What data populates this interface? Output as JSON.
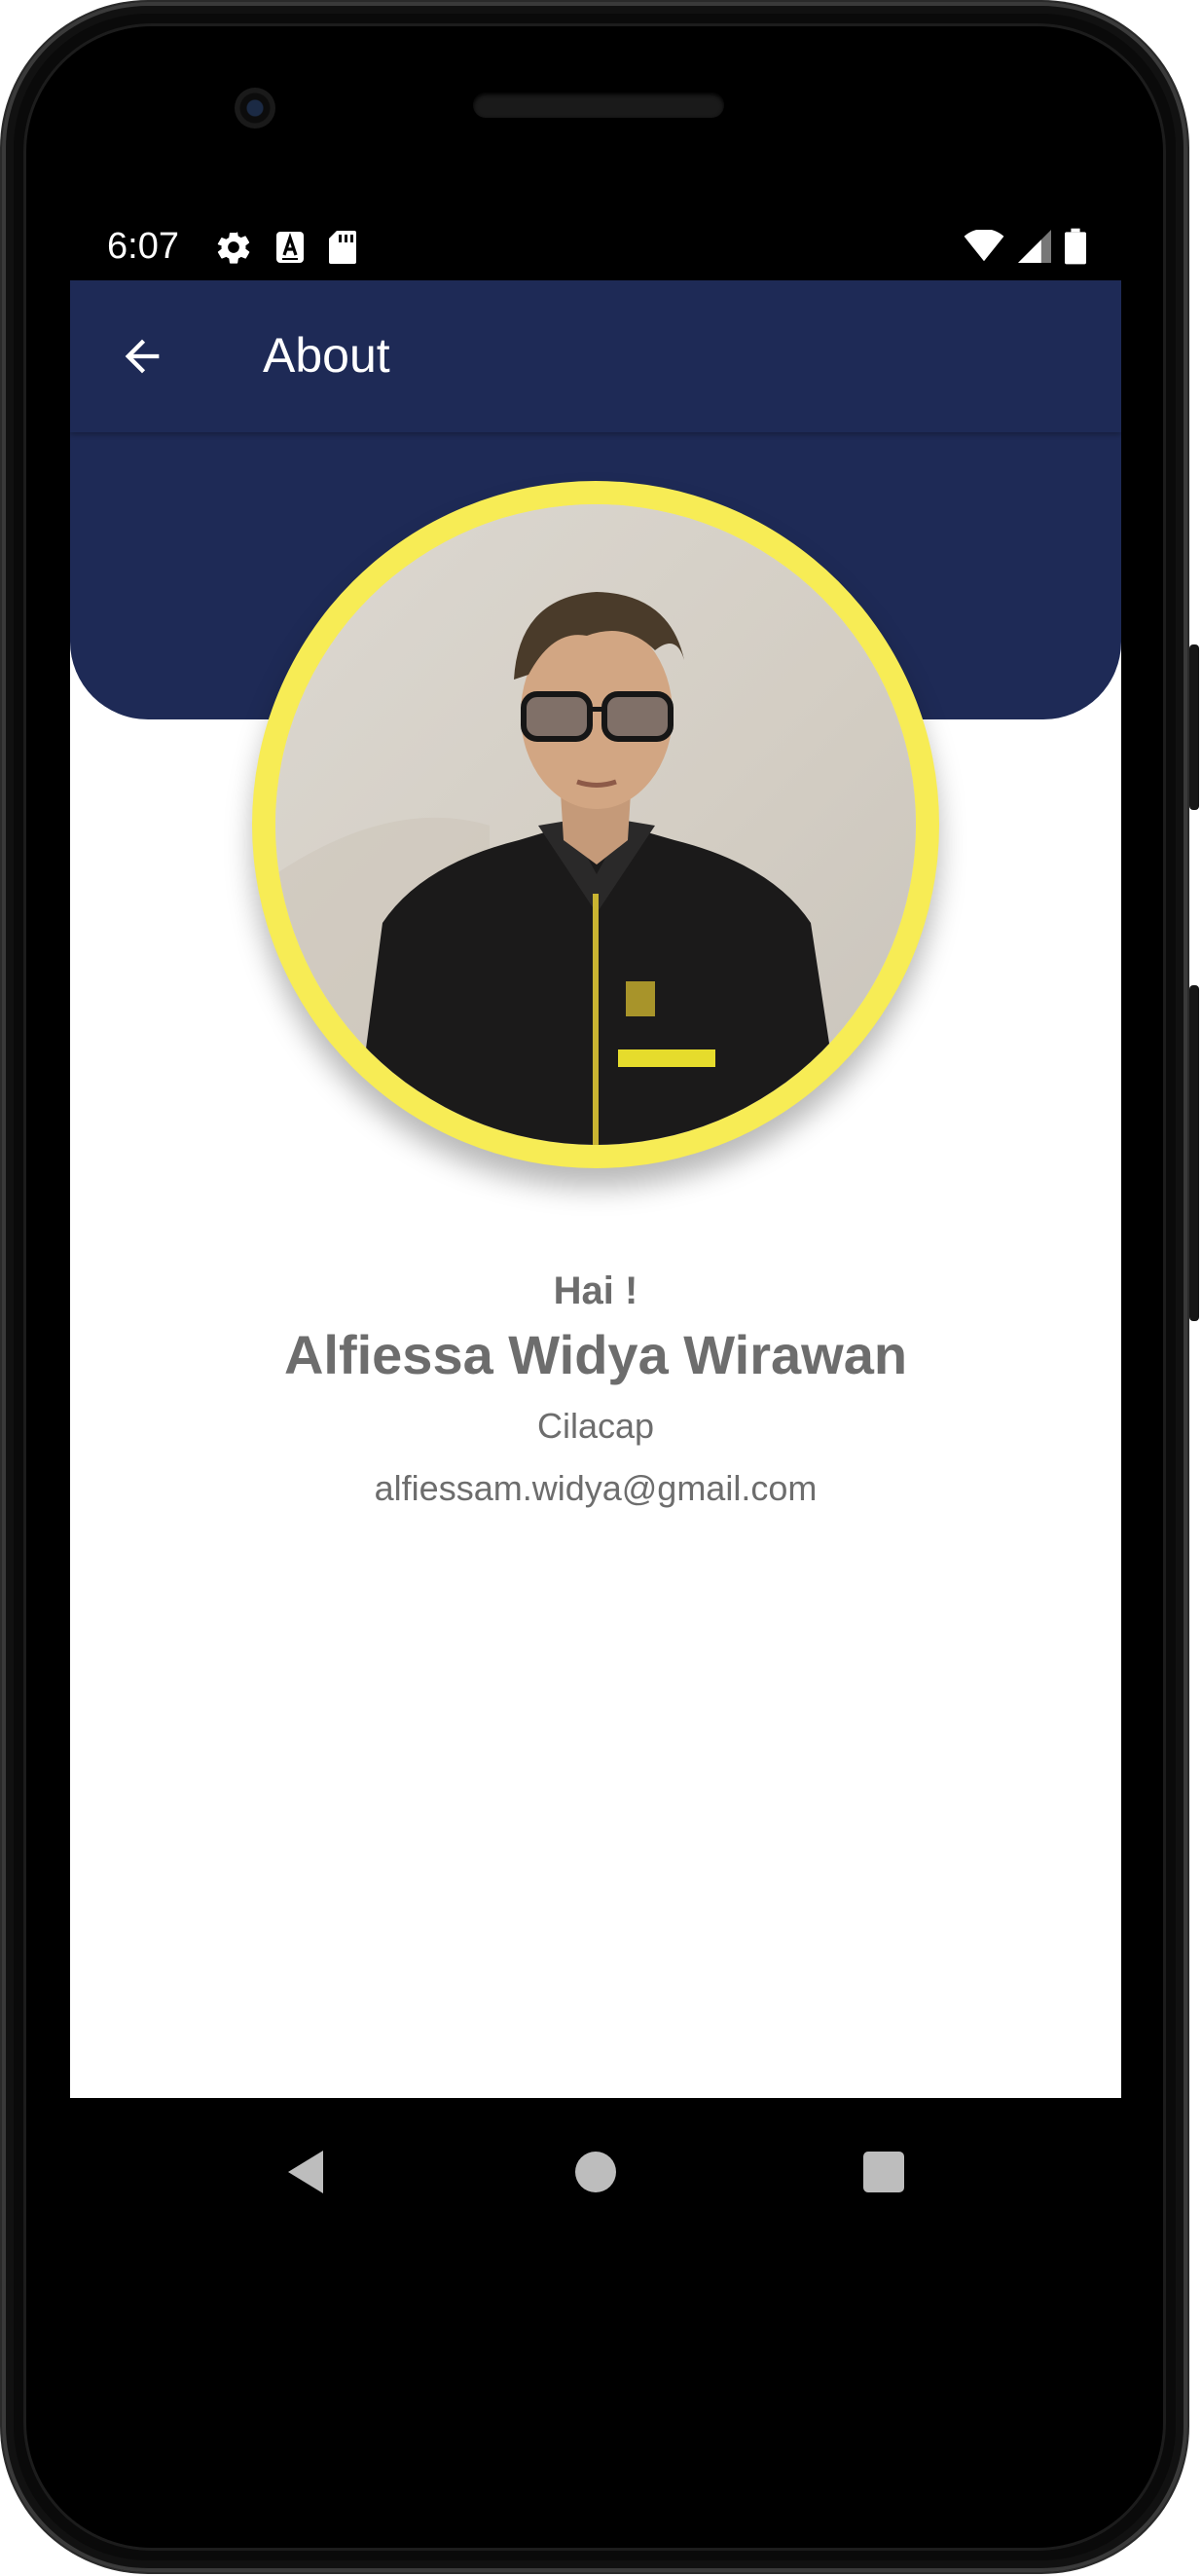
{
  "statusbar": {
    "time": "6:07",
    "left_icons": [
      "gear-icon",
      "a-badge-icon",
      "sd-card-icon"
    ],
    "right_icons": [
      "wifi-icon",
      "signal-icon",
      "battery-icon"
    ]
  },
  "appbar": {
    "title": "About",
    "back_icon": "arrow-left-icon"
  },
  "profile": {
    "photo": "profile-photo",
    "greeting": "Hai !",
    "name": "Alfiessa Widya Wirawan",
    "city": "Cilacap",
    "email": "alfiessam.widya@gmail.com"
  },
  "colors": {
    "primary": "#1e2a56",
    "avatar_ring": "#f7ec55",
    "text": "#6d6d6d",
    "background": "#ffffff"
  },
  "navbar": {
    "icons": [
      "nav-back-icon",
      "nav-home-icon",
      "nav-recents-icon"
    ]
  }
}
